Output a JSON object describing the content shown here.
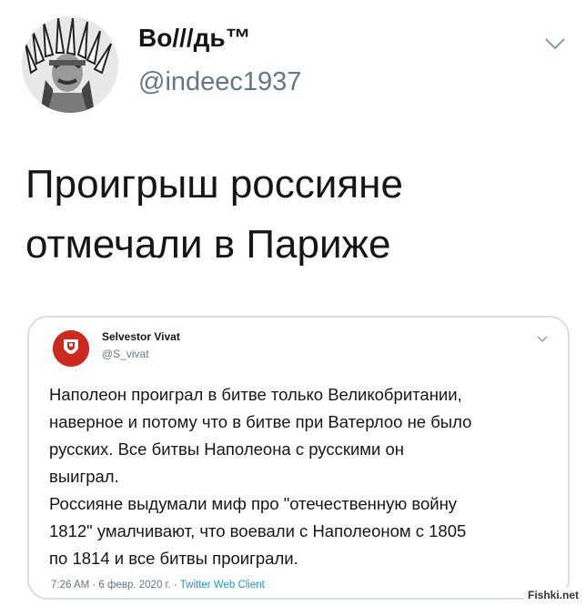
{
  "author": {
    "display_name": "Во///дь™",
    "handle": "@indeec1937",
    "avatar_icon": "headdress-portrait-avatar"
  },
  "tweet": {
    "text": "Проигрыш россияне\nотмечали в Париже"
  },
  "quoted_tweet": {
    "display_name": "Selvestor Vivat",
    "handle": "@S_vivat",
    "avatar_icon": "red-emblem-avatar",
    "text": "Наполеон проиграл в битве только Великобритании,\nнаверное и потому что в битве при Ватерлоо не было\nрусских. Все битвы Наполеона с русскими он\nвыиграл.\nРоссияне выдумали миф про \"отечественную войну\n1812\" умалчивают, что воевали с Наполеоном с 1805\nпо 1814 и все битвы проиграли.",
    "meta_prefix": "7:26 AM · 6 февр. 2020 г. · ",
    "source": "Twitter Web Client"
  },
  "watermark": "Fishki.net",
  "colors": {
    "text": "#14171a",
    "secondary": "#657786",
    "link": "#1b95e0",
    "border": "#d9dee2"
  }
}
